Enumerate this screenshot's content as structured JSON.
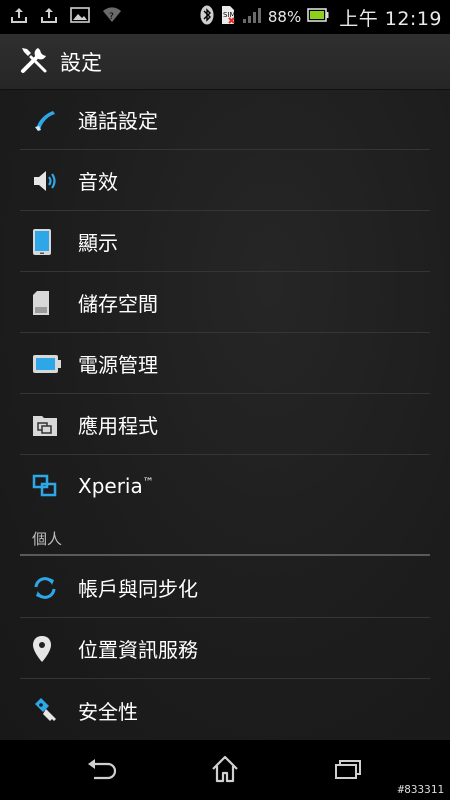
{
  "status_bar": {
    "battery_percent": "88%",
    "time": "上午 12:19",
    "icons": [
      "upload-icon",
      "upload-icon",
      "image-icon",
      "wifi-icon",
      "bluetooth-icon",
      "sim-missing-icon",
      "signal-icon",
      "battery-icon"
    ]
  },
  "action_bar": {
    "title": "設定",
    "icon": "wrench-screwdriver-icon"
  },
  "settings": {
    "items": [
      {
        "label": "通話設定",
        "icon": "phone-icon"
      },
      {
        "label": "音效",
        "icon": "speaker-icon"
      },
      {
        "label": "顯示",
        "icon": "display-icon"
      },
      {
        "label": "儲存空間",
        "icon": "sd-card-icon"
      },
      {
        "label": "電源管理",
        "icon": "battery-icon"
      },
      {
        "label": "應用程式",
        "icon": "apps-icon"
      },
      {
        "label": "Xperia",
        "tm": "™",
        "icon": "xperia-icon"
      }
    ],
    "section_personal": "個人",
    "personal_items": [
      {
        "label": "帳戶與同步化",
        "icon": "sync-icon"
      },
      {
        "label": "位置資訊服務",
        "icon": "location-pin-icon"
      },
      {
        "label": "安全性",
        "icon": "key-icon"
      }
    ]
  },
  "nav_bar": {
    "buttons": [
      "back-icon",
      "home-icon",
      "recents-icon"
    ]
  },
  "watermark": "#833311"
}
